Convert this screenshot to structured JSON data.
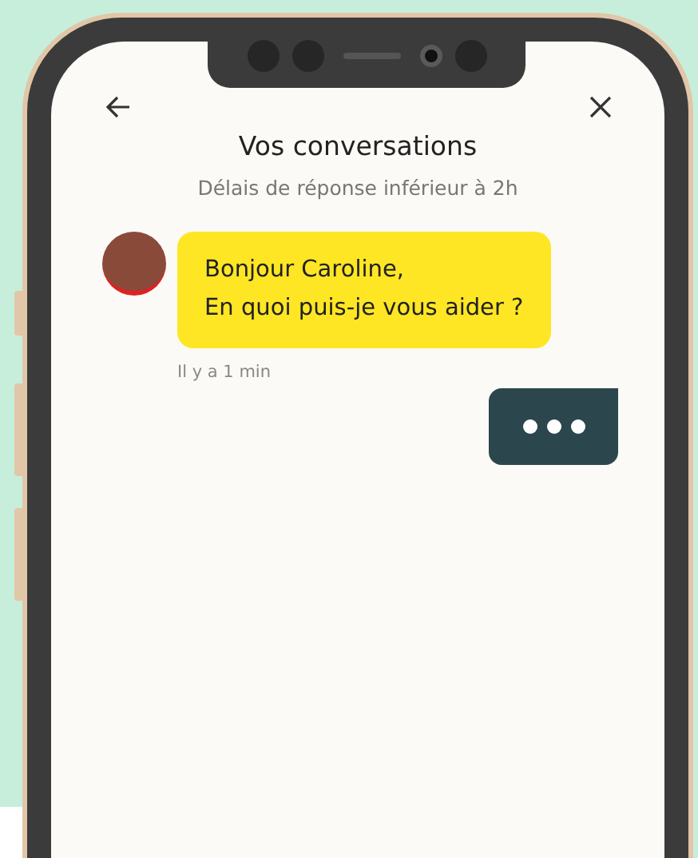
{
  "header": {
    "title": "Vos conversations",
    "subtitle": "Délais de réponse inférieur à 2h"
  },
  "messages": [
    {
      "kind": "received",
      "lines": [
        "Bonjour Caroline,",
        "En quoi puis-je vous aider ?"
      ],
      "time": "Il y a 1 min"
    },
    {
      "kind": "typing"
    }
  ]
}
